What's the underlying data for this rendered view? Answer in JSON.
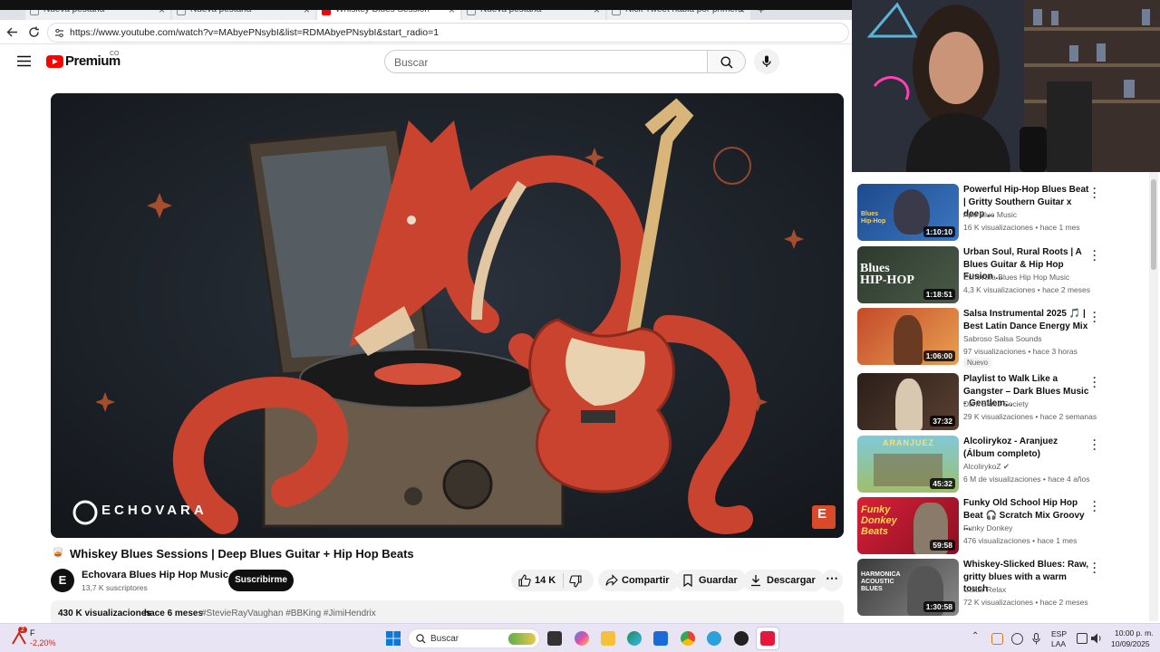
{
  "browser": {
    "tabs": [
      {
        "label": "Nueva pestaña"
      },
      {
        "label": "Nueva pestaña"
      },
      {
        "label": "Whiskey Blues Session"
      },
      {
        "label": "Nueva pestaña"
      },
      {
        "label": "Nick Tweet habla por primera"
      }
    ],
    "url": "https://www.youtube.com/watch?v=MAbyePNsybI&list=RDMAbyePNsybI&start_radio=1"
  },
  "header": {
    "logo_text": "Premium",
    "country": "CO",
    "search_placeholder": "Buscar"
  },
  "player": {
    "brand_watermark": "ECHOVARA",
    "corner_logo": "E"
  },
  "video": {
    "title_prefix": "🥃",
    "title": "Whiskey Blues Sessions | Deep Blues Guitar + Hip Hop Beats",
    "channel_name": "Echovara Blues Hip Hop Music",
    "channel_avatar_letter": "E",
    "subscribers": "13,7 K suscriptores",
    "subscribe_label": "Suscribirme",
    "likes": "14 K",
    "share_label": "Compartir",
    "save_label": "Guardar",
    "download_label": "Descargar",
    "views": "430 K visualizaciones",
    "age": "hace 6 meses",
    "hashtags": "#StevieRayVaughan #BBKing #JimiHendrix"
  },
  "sidebar": {
    "items": [
      {
        "title": "Powerful Hip-Hop Blues Beat | Gritty Southern Guitar x deep ...",
        "channel": "Ape Blue Music",
        "stats": "16 K visualizaciones • hace 1 mes",
        "duration": "1:10:10",
        "thumb_text": "Blues Hip-Hop",
        "badge": ""
      },
      {
        "title": "Urban Soul, Rural Roots | A Blues Guitar & Hip Hop Fusion ...",
        "channel": "Echovara Blues Hip Hop Music",
        "stats": "4,3 K visualizaciones • hace 2 meses",
        "duration": "1:18:51",
        "thumb_text": "Blues HIP-HOP",
        "badge": ""
      },
      {
        "title": "Salsa Instrumental 2025 🎵 | Best Latin Dance Energy Mix",
        "channel": "Sabroso Salsa Sounds",
        "stats": "97 visualizaciones • hace 3 horas",
        "duration": "1:06:00",
        "thumb_text": "",
        "badge": "Nuevo"
      },
      {
        "title": "Playlist to Walk Like a Gangster – Dark Blues Music - Gentlem...",
        "channel": "Dark Blues Society",
        "stats": "29 K visualizaciones • hace 2 semanas",
        "duration": "37:32",
        "thumb_text": "",
        "badge": ""
      },
      {
        "title": "Alcolirykoz - Aranjuez (Álbum completo)",
        "channel": "AlcolirykoZ ✔",
        "stats": "6 M de visualizaciones • hace 4 años",
        "duration": "45:32",
        "thumb_text": "ARANJUEZ",
        "badge": ""
      },
      {
        "title": "Funky Old School Hip Hop Beat 🎧 Scratch Mix  Groovy ...",
        "channel": "Funky Donkey",
        "stats": "476 visualizaciones • hace 1 mes",
        "duration": "59:58",
        "thumb_text": "Funky Donkey Beats",
        "badge": ""
      },
      {
        "title": "Whiskey-Slicked Blues: Raw, gritty blues with a warm touch",
        "channel": "Guitar Relax",
        "stats": "72 K visualizaciones • hace 2 meses",
        "duration": "1:30:58",
        "thumb_text": "HARMONICA ACOUSTIC BLUES",
        "badge": ""
      }
    ]
  },
  "taskbar": {
    "stock_badge": "2",
    "stock_name": "F",
    "stock_change": "-2,20%",
    "search_label": "Buscar",
    "lang_primary": "ESP",
    "lang_secondary": "LAA",
    "time": "10:00 p. m.",
    "date": "10/09/2025"
  },
  "colors": {
    "youtube_red": "#ff0000",
    "text": "#0f0f0f",
    "meta": "#606060",
    "stock_down": "#c42b1c"
  }
}
